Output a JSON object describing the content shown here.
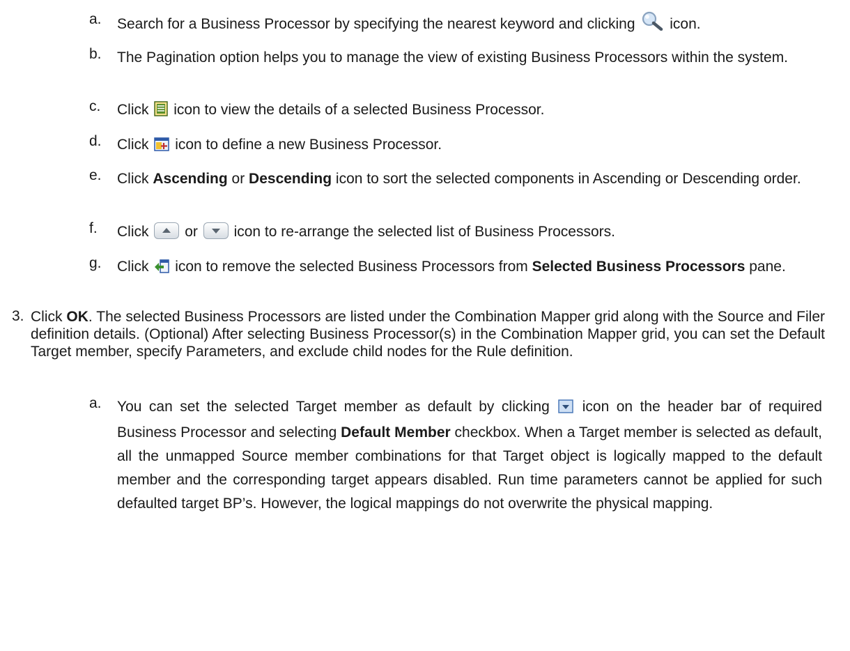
{
  "steps": {
    "a": {
      "marker": "a.",
      "pre": "Search for a Business Processor by specifying the nearest keyword and clicking",
      "post": "icon."
    },
    "b": {
      "marker": "b.",
      "text": "The Pagination option helps you to manage the view of existing Business Processors within the system."
    },
    "c": {
      "marker": "c.",
      "pre": "Click",
      "post": "icon to view the details of a selected Business Processor."
    },
    "d": {
      "marker": "d.",
      "pre": "Click",
      "post": "icon to define a new Business Processor."
    },
    "e": {
      "marker": "e.",
      "p1": "Click ",
      "b1": "Ascending",
      "p2": " or ",
      "b2": "Descending",
      "p3": " icon to sort the selected components in Ascending or Descending order."
    },
    "f": {
      "marker": "f.",
      "pre": "Click",
      "mid": "or",
      "post": "icon to re-arrange the selected list of Business Processors."
    },
    "g": {
      "marker": "g.",
      "pre": "Click",
      "post": "icon to remove the selected Business Processors from ",
      "bold": "Selected Business Processors",
      "end": " pane."
    }
  },
  "step3": {
    "marker": "3.",
    "p1": "Click ",
    "b1": "OK",
    "p2": ". The selected Business Processors are listed under the Combination Mapper grid along with the Source and Filer definition details. (Optional) After selecting Business Processor(s) in the Combination Mapper grid, you can set the Default Target member, specify Parameters, and exclude child nodes for the Rule definition."
  },
  "step3a": {
    "marker": "a.",
    "p1": "You can set the selected Target member as default by clicking",
    "p2": "icon on the header bar of required Business Processor and selecting ",
    "b1": "Default Member",
    "p3": " checkbox. When a Target member is selected as default, all the unmapped Source member combinations for that Target object is logically mapped to the default member and the corresponding target appears disabled. Run time parameters cannot be applied for such defaulted target BP’s. However, the logical mappings do not overwrite the physical mapping."
  },
  "icons": [
    "search-icon",
    "view-details-icon",
    "add-new-icon",
    "move-up-icon",
    "move-down-icon",
    "remove-icon",
    "dropdown-icon"
  ]
}
